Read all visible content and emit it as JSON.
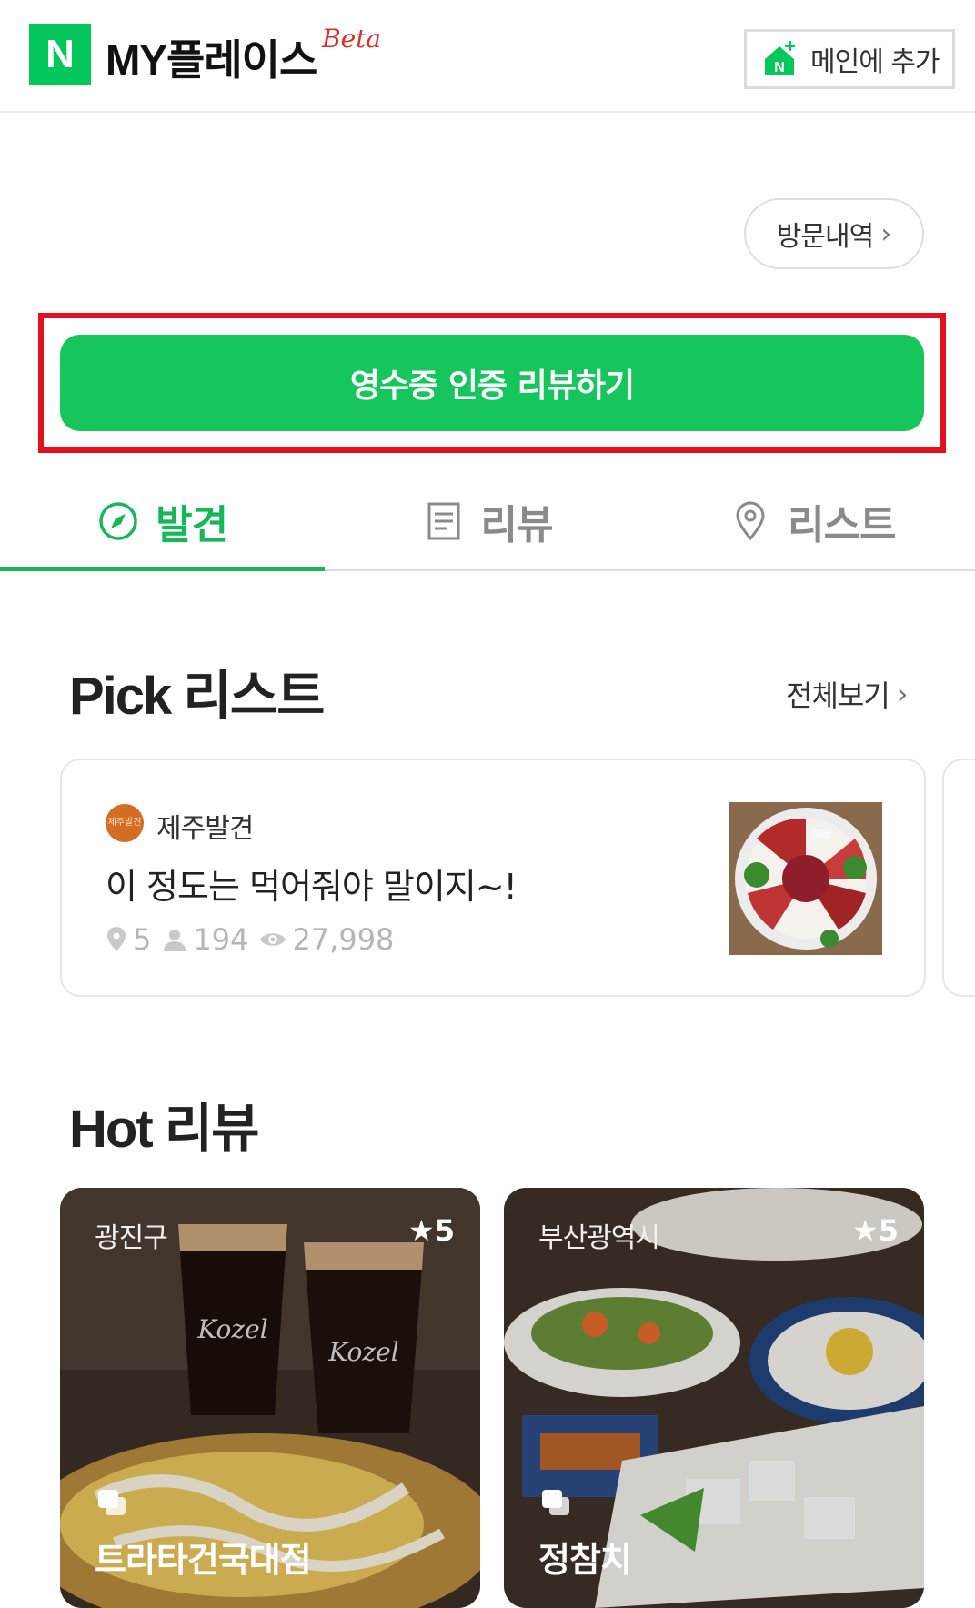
{
  "header": {
    "logo": "N",
    "title": "MY플레이스",
    "badge": "Beta",
    "add_to_main": "메인에 추가"
  },
  "visit_history": {
    "label": "방문내역",
    "chevron": "›"
  },
  "review_button": {
    "label": "영수증 인증 리뷰하기"
  },
  "tabs": [
    {
      "label": "발견",
      "icon": "compass-icon",
      "active": true
    },
    {
      "label": "리뷰",
      "icon": "document-icon",
      "active": false
    },
    {
      "label": "리스트",
      "icon": "location-pin-icon",
      "active": false
    }
  ],
  "pick": {
    "title": "Pick 리스트",
    "see_all": "전체보기",
    "card": {
      "author_avatar_text": "제주발견",
      "author": "제주발견",
      "title": "이 정도는 먹어줘야 말이지~!",
      "places": "5",
      "followers": "194",
      "views": "27,998"
    }
  },
  "hot": {
    "title": "Hot 리뷰",
    "cards": [
      {
        "region": "광진구",
        "rating": "★5",
        "place": "트라타건국대점"
      },
      {
        "region": "부산광역시",
        "rating": "★5",
        "place": "정참치"
      }
    ]
  },
  "colors": {
    "brand_green": "#03c75a",
    "button_green": "#16c55b",
    "highlight_red": "#e3101d"
  }
}
